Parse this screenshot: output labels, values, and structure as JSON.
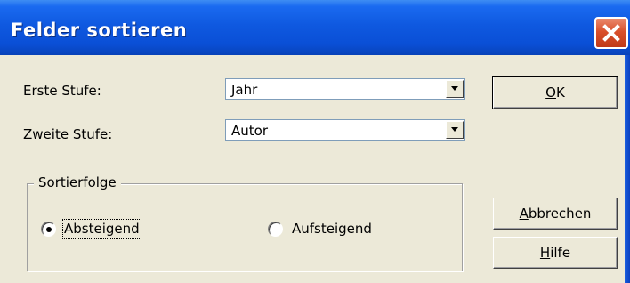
{
  "window": {
    "title": "Felder sortieren"
  },
  "icons": {
    "close": "close-icon",
    "dropdown": "chevron-down-icon"
  },
  "fields": {
    "first_level": {
      "label": "Erste Stufe:",
      "value": "Jahr"
    },
    "second_level": {
      "label": "Zweite Stufe:",
      "value": "Autor"
    }
  },
  "sort_order": {
    "group_label": "Sortierfolge",
    "options": [
      {
        "label": "Absteigend",
        "selected": true
      },
      {
        "label": "Aufsteigend",
        "selected": false
      }
    ]
  },
  "buttons": {
    "ok": {
      "mnemonic": "O",
      "rest": "K"
    },
    "cancel": {
      "mnemonic": "A",
      "rest": "bbrechen"
    },
    "help": {
      "mnemonic": "H",
      "rest": "ilfe"
    }
  },
  "colors": {
    "titlebar": "#0a4fd6",
    "dialog_bg": "#ece9d8",
    "close_red": "#d9502c"
  }
}
